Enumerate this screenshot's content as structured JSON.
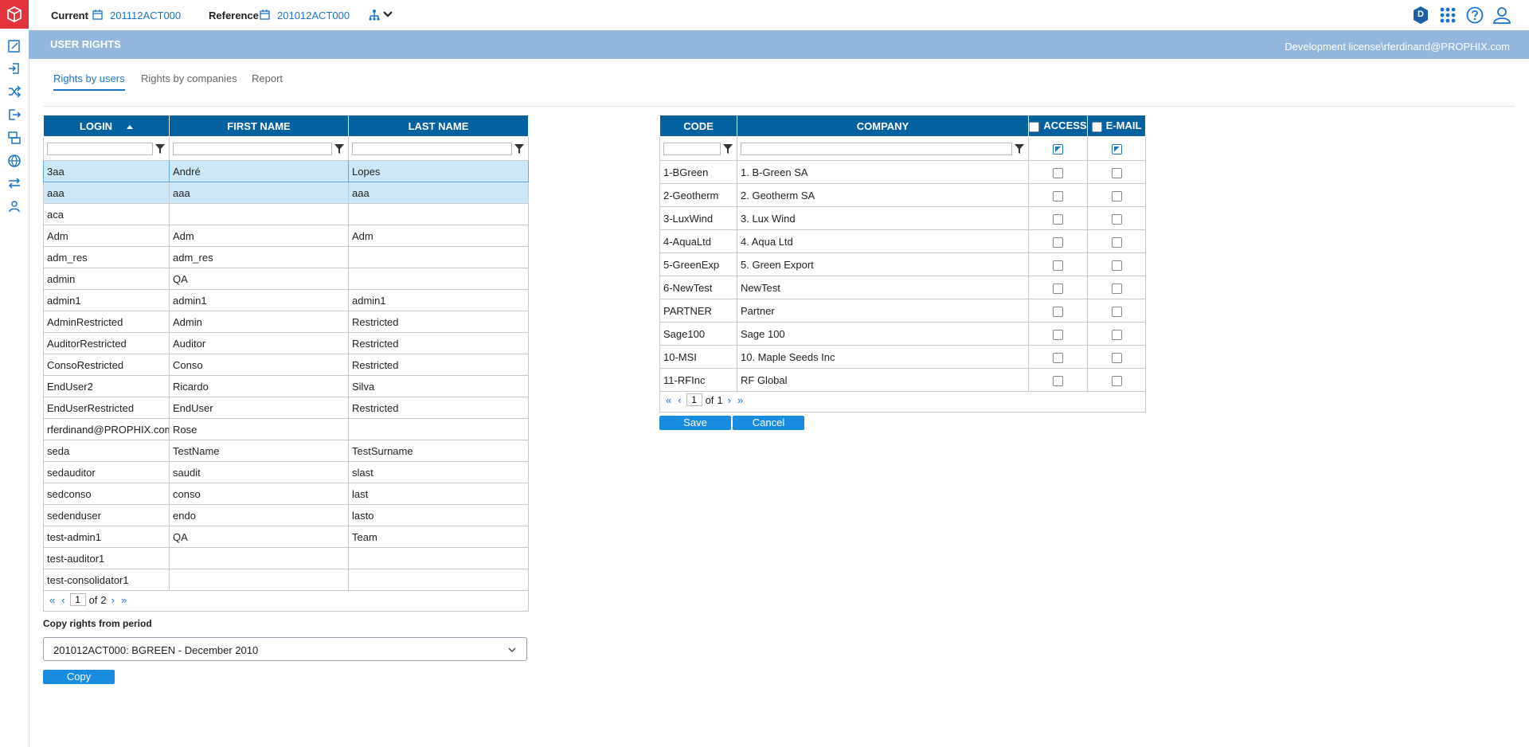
{
  "topbar": {
    "current_label": "Current",
    "current_value": "201112ACT000",
    "reference_label": "Reference",
    "reference_value": "201012ACT000",
    "user_initial": "D"
  },
  "band": {
    "title": "USER RIGHTS",
    "license": "Development license\\rferdinand@PROPHIX.com"
  },
  "tabs": [
    {
      "label": "Rights by users",
      "active": true
    },
    {
      "label": "Rights by companies",
      "active": false
    },
    {
      "label": "Report",
      "active": false
    }
  ],
  "users_grid": {
    "columns": [
      "LOGIN",
      "FIRST NAME",
      "LAST NAME"
    ],
    "rows": [
      [
        "3aa",
        "André",
        "Lopes"
      ],
      [
        "aaa",
        "aaa",
        "aaa"
      ],
      [
        "aca",
        "",
        ""
      ],
      [
        "Adm",
        "Adm",
        "Adm"
      ],
      [
        "adm_res",
        "adm_res",
        ""
      ],
      [
        "admin",
        "QA",
        ""
      ],
      [
        "admin1",
        "admin1",
        "admin1"
      ],
      [
        "AdminRestricted",
        "Admin",
        "Restricted"
      ],
      [
        "AuditorRestricted",
        "Auditor",
        "Restricted"
      ],
      [
        "ConsoRestricted",
        "Conso",
        "Restricted"
      ],
      [
        "EndUser2",
        "Ricardo",
        "Silva"
      ],
      [
        "EndUserRestricted",
        "EndUser",
        "Restricted"
      ],
      [
        "rferdinand@PROPHIX.com",
        "Rose",
        ""
      ],
      [
        "seda",
        "TestName",
        "TestSurname"
      ],
      [
        "sedauditor",
        "saudit",
        "slast"
      ],
      [
        "sedconso",
        "conso",
        "last"
      ],
      [
        "sedenduser",
        "endo",
        "lasto"
      ],
      [
        "test-admin1",
        "QA",
        "Team"
      ],
      [
        "test-auditor1",
        "",
        ""
      ],
      [
        "test-consolidator1",
        "",
        ""
      ]
    ],
    "pager": {
      "page": "1",
      "of_label": "of",
      "total": "2"
    }
  },
  "copy": {
    "label": "Copy rights from period",
    "selected": "201012ACT000: BGREEN - December 2010",
    "button": "Copy"
  },
  "companies_grid": {
    "columns": [
      "CODE",
      "COMPANY",
      "ACCESS",
      "E-MAIL"
    ],
    "rows": [
      [
        "1-BGreen",
        "1. B-Green SA"
      ],
      [
        "2-Geotherm",
        "2. Geotherm SA"
      ],
      [
        "3-LuxWind",
        "3. Lux Wind"
      ],
      [
        "4-AquaLtd",
        "4. Aqua Ltd"
      ],
      [
        "5-GreenExp",
        "5. Green Export"
      ],
      [
        "6-NewTest",
        "NewTest"
      ],
      [
        "PARTNER",
        "Partner"
      ],
      [
        "Sage100",
        "Sage 100"
      ],
      [
        "10-MSI",
        "10. Maple Seeds Inc"
      ],
      [
        "11-RFInc",
        "RF Global"
      ]
    ],
    "pager": {
      "page": "1",
      "of_label": "of",
      "total": "1"
    },
    "save": "Save",
    "cancel": "Cancel"
  },
  "colors": {
    "header": "#04619f",
    "band": "#93b6dd",
    "accent": "#1a73c9",
    "logo": "#e3333d",
    "selected_row": "#cce8f8"
  }
}
